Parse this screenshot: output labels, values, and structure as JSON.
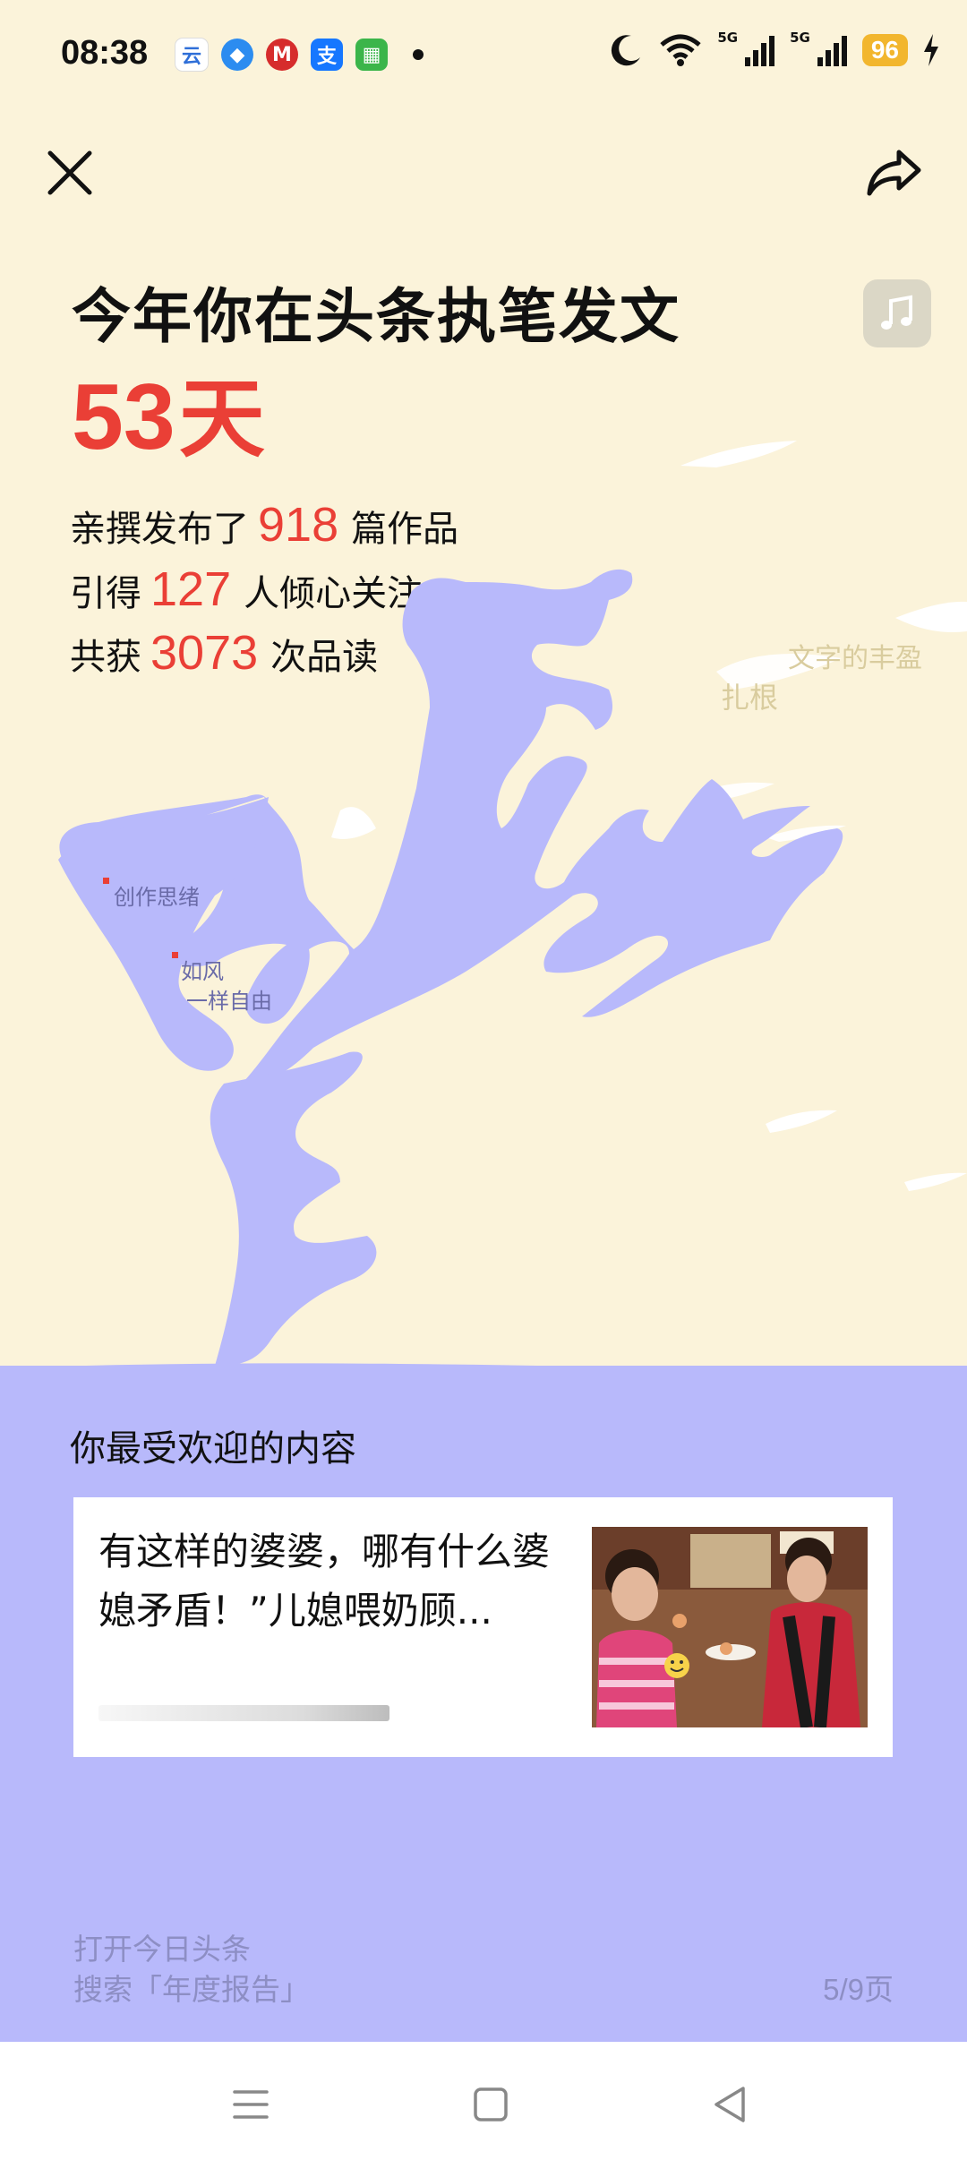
{
  "status_bar": {
    "time": "08:38",
    "app_icons": [
      {
        "name": "yunfu-icon",
        "glyph": "云",
        "color": "#FFFFFF",
        "fg": "#2F6FD8"
      },
      {
        "name": "feather-icon",
        "glyph": "◆",
        "color": "#2C8CF0",
        "fg": "#FFFFFF"
      },
      {
        "name": "metro-icon",
        "glyph": "M",
        "color": "#D62C2C",
        "fg": "#FFFFFF"
      },
      {
        "name": "alipay-icon",
        "glyph": "支",
        "color": "#1677FF",
        "fg": "#FFFFFF"
      },
      {
        "name": "green-app-icon",
        "glyph": "▦",
        "color": "#3BB54A",
        "fg": "#FFFFFF"
      }
    ],
    "net1": "5G",
    "net2": "5G",
    "battery": "96"
  },
  "report": {
    "title": "今年你在头条执笔发文",
    "days_number": "53",
    "days_unit": "天",
    "stats": [
      {
        "prefix": "亲撰发布了",
        "value": "918",
        "suffix": "篇作品"
      },
      {
        "prefix": "引得",
        "value": "127",
        "suffix": "人倾心关注"
      },
      {
        "prefix": "共获",
        "value": "3073",
        "suffix": "次品读"
      }
    ]
  },
  "map": {
    "labels": {
      "creative": "创作思绪",
      "wind": "如风",
      "free": "一样自由",
      "rich": "文字的丰盈",
      "root": "扎根"
    }
  },
  "popular": {
    "heading": "你最受欢迎的内容",
    "article_title": "有这样的婆婆，哪有什么婆媳矛盾！”儿媳喂奶顾..."
  },
  "footer": {
    "line1": "打开今日头条",
    "line2": "搜索「年度报告」",
    "page": "5/9页"
  },
  "colors": {
    "background": "#FBF3DA",
    "accent_red": "#EA3F36",
    "lavender": "#B8B9FB",
    "footer_text": "#8D8EC4"
  }
}
